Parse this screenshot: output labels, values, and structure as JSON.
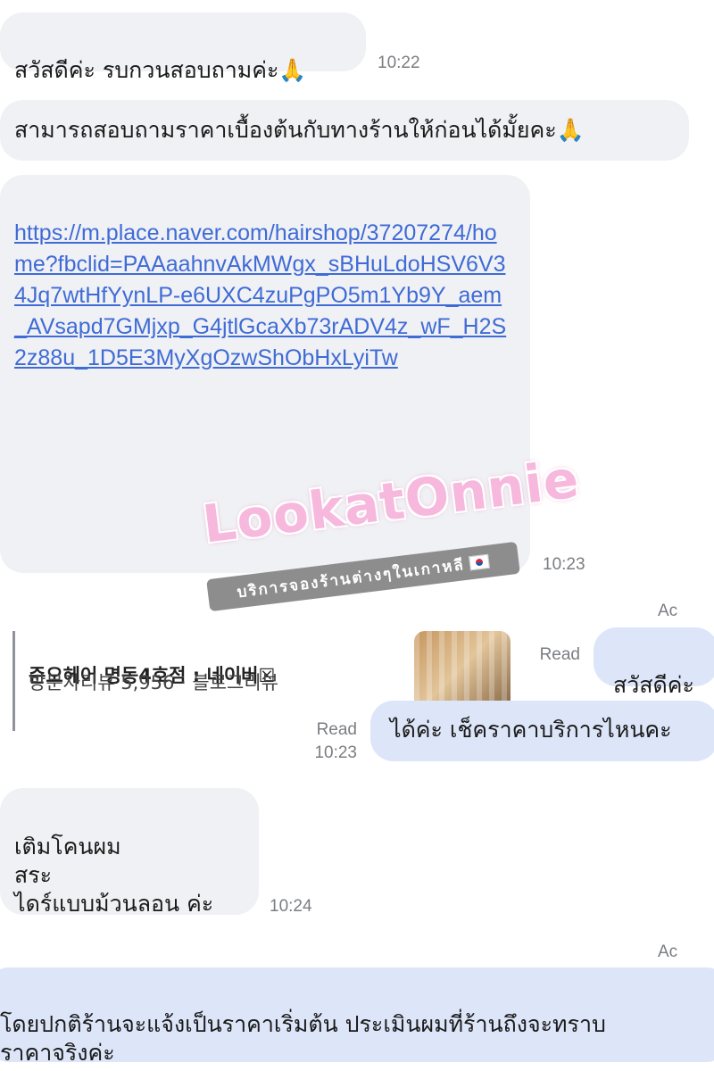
{
  "messages": {
    "m1": {
      "text": "สวัสดีค่ะ รบกวนสอบถามค่ะ🙏",
      "time": "10:22"
    },
    "m2": {
      "text": "สามารถสอบถามราคาเบื้องต้นกับทางร้านให้ก่อนได้มั้ยคะ🙏"
    },
    "m3": {
      "link": "https://m.place.naver.com/hairshop/37207274/home?fbclid=PAAaahnvAkMWgx_sBHuLdoHSV6V34Jq7wtHfYynLP-e6UXC4zuPgPO5m1Yb9Y_aem_AVsapd7GMjxp_G4jtlGcaXb73rADV4z_wF_H2S2z88u_1D5E3MyXgOzwShObHxLyiTw",
      "preview_title": "준오헤어 명동4호점 : 네이버",
      "preview_sub": "방문자리뷰 5,956 · 블로그리뷰",
      "time": "10:23"
    },
    "edge_label_1": "Ac",
    "m4": {
      "text": "สวัสดีค่ะ",
      "read": "Read"
    },
    "m5": {
      "text": "ได้ค่ะ เช็คราคาบริการไหนคะ",
      "read": "Read",
      "time": "10:23"
    },
    "m6": {
      "text": "เติมโคนผม\nสระ\nไดร์แบบม้วนลอน ค่ะ",
      "time": "10:24"
    },
    "edge_label_2": "Ac",
    "m7": {
      "text": "โดยปกติร้านจะแจ้งเป็นราคาเริ่มต้น ประเมินผมที่ร้านถึงจะทราบ\nราคาจริงค่ะ"
    }
  },
  "watermark": {
    "logo": "LookatOnnie",
    "banner": "บริการจองร้านต่างๆในเกาหลี"
  },
  "colors": {
    "incoming_bubble": "#f0f1f4",
    "outgoing_bubble": "#dde5f9",
    "link": "#3f6bd6",
    "watermark_pink": "#f6b8dc"
  }
}
